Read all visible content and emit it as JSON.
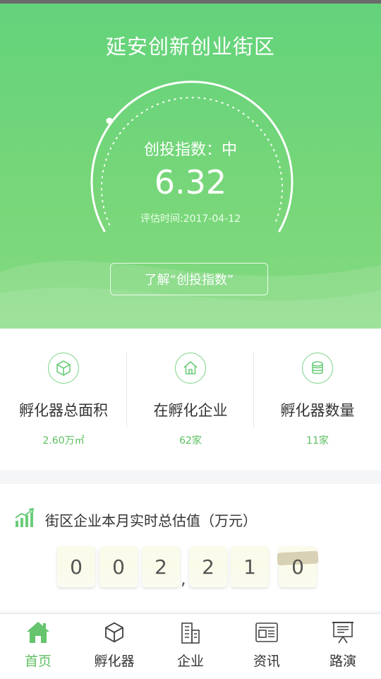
{
  "hero": {
    "title": "延安创新创业街区",
    "index_label": "创投指数：中",
    "index_value": "6.32",
    "eval_date": "评估时间:2017-04-12",
    "learn_button": "了解“创投指数”"
  },
  "stats": [
    {
      "icon": "cube-icon",
      "label": "孵化器总面积",
      "value": "2.60万㎡"
    },
    {
      "icon": "house-icon",
      "label": "在孵化企业",
      "value": "62家"
    },
    {
      "icon": "coin-stack-icon",
      "label": "孵化器数量",
      "value": "11家"
    }
  ],
  "valuation": {
    "icon": "bar-chart-trend-icon",
    "title": "街区企业本月实时总估值（万元）",
    "digits": [
      "0",
      "0",
      "2",
      "2",
      "1",
      "0"
    ],
    "separator": ","
  },
  "nav": {
    "items": [
      {
        "icon": "home-icon",
        "label": "首页",
        "active": true
      },
      {
        "icon": "cube-icon",
        "label": "孵化器",
        "active": false
      },
      {
        "icon": "building-icon",
        "label": "企业",
        "active": false
      },
      {
        "icon": "news-icon",
        "label": "资讯",
        "active": false
      },
      {
        "icon": "presentation-icon",
        "label": "路演",
        "active": false
      }
    ]
  },
  "colors": {
    "accent": "#6fd67a",
    "accent_text": "#5fbf64"
  }
}
